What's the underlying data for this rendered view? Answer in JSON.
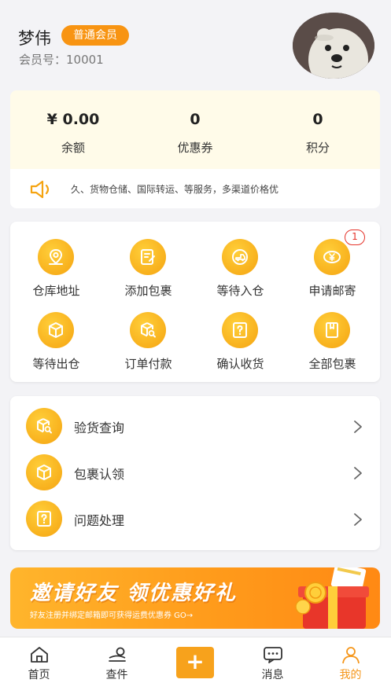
{
  "user": {
    "name": "梦伟",
    "member_level": "普通会员",
    "member_no": "会员号：10001"
  },
  "stats": [
    {
      "value": "¥ 0.00",
      "label": "余额"
    },
    {
      "value": "0",
      "label": "优惠券"
    },
    {
      "value": "0",
      "label": "积分"
    }
  ],
  "notice": {
    "text": "久、货物仓储、国际转运、等服务，多渠道价格优"
  },
  "orders": {
    "items": [
      {
        "label": "仓库地址",
        "icon": "location-pin-icon"
      },
      {
        "label": "添加包裹",
        "icon": "edit-document-icon"
      },
      {
        "label": "等待入仓",
        "icon": "truck-icon"
      },
      {
        "label": "申请邮寄",
        "icon": "yuan-coin-icon",
        "badge": "1"
      },
      {
        "label": "等待出仓",
        "icon": "box-icon"
      },
      {
        "label": "订单付款",
        "icon": "box-search-icon"
      },
      {
        "label": "确认收货",
        "icon": "question-box-icon"
      },
      {
        "label": "全部包裹",
        "icon": "book-icon"
      }
    ]
  },
  "services": {
    "items": [
      {
        "label": "验货查询",
        "icon": "box-search-icon"
      },
      {
        "label": "包裹认领",
        "icon": "box-icon"
      },
      {
        "label": "问题处理",
        "icon": "question-box-icon"
      }
    ]
  },
  "banner": {
    "title": "邀请好友 领优惠好礼",
    "subtitle": "好友注册并绑定邮箱即可获得运费优惠券 GO→"
  },
  "nav": {
    "items": [
      {
        "label": "首页",
        "icon": "home-icon"
      },
      {
        "label": "查件",
        "icon": "track-icon"
      },
      {
        "label": "+",
        "icon": "add-icon"
      },
      {
        "label": "消息",
        "icon": "message-icon"
      },
      {
        "label": "我的",
        "icon": "profile-icon",
        "active": true
      }
    ]
  },
  "colors": {
    "accent": "#f89412",
    "icon_gold": "#f5a310",
    "active_nav": "#f5961a",
    "badge_red": "#e5332a"
  }
}
